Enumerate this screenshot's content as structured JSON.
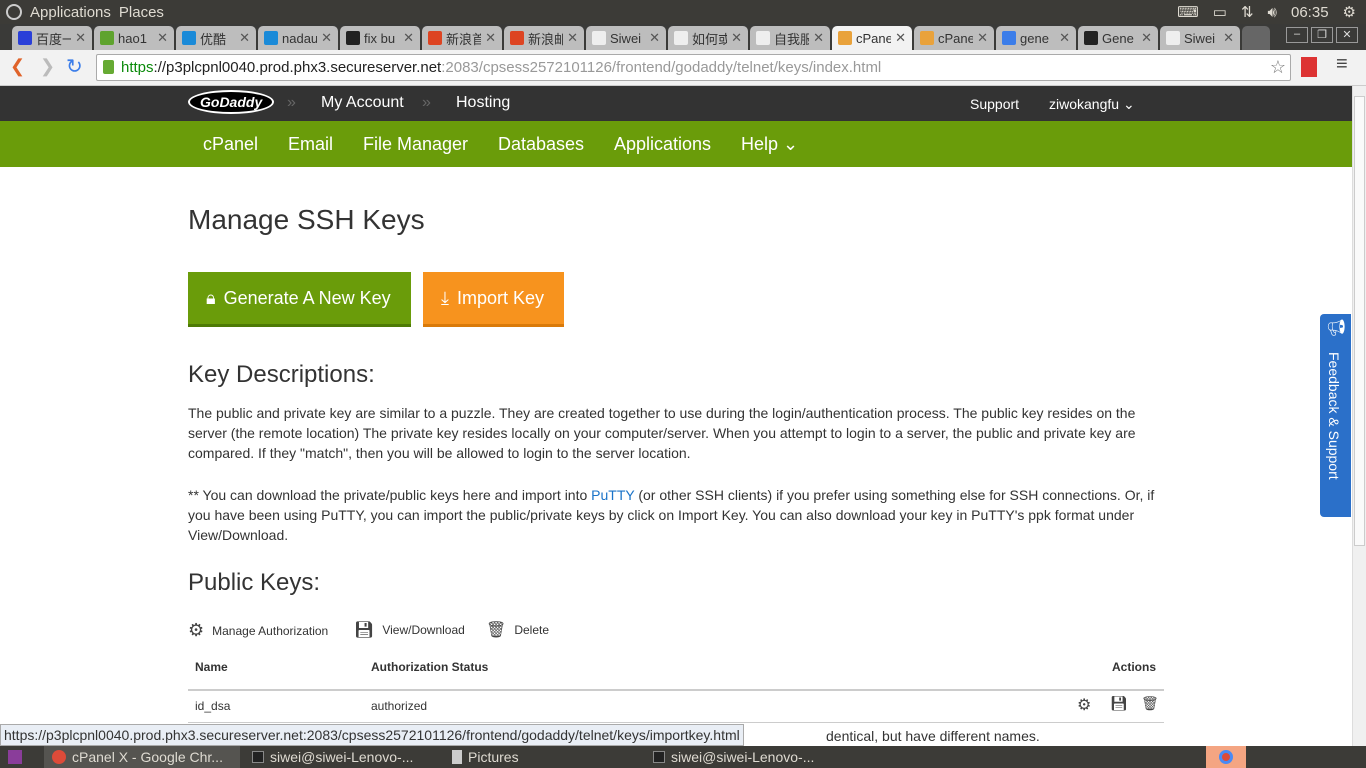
{
  "panel": {
    "applications": "Applications",
    "places": "Places",
    "time": "06:35"
  },
  "tabs": [
    {
      "label": "百度一",
      "color": "#2a3fd8"
    },
    {
      "label": "hao1",
      "color": "#5fa32e"
    },
    {
      "label": "优酷",
      "color": "#1a8ad8"
    },
    {
      "label": "nadau",
      "color": "#1a8ad8"
    },
    {
      "label": "fix bu",
      "color": "#222"
    },
    {
      "label": "新浪首",
      "color": "#d42"
    },
    {
      "label": "新浪邮",
      "color": "#d42"
    },
    {
      "label": "Siwei",
      "color": "#eee"
    },
    {
      "label": "如何或",
      "color": "#eee"
    },
    {
      "label": "自我服",
      "color": "#eee"
    },
    {
      "label": "cPane",
      "color": "#e9a23b",
      "active": true
    },
    {
      "label": "cPane",
      "color": "#e9a23b"
    },
    {
      "label": "gene",
      "color": "#3b7de9"
    },
    {
      "label": "Gene",
      "color": "#222"
    },
    {
      "label": "Siwei",
      "color": "#eee"
    }
  ],
  "url": {
    "scheme": "https",
    "host": "://p3plcpnl0040.prod.phx3.secureserver.net",
    "path": ":2083/cpsess2572101126/frontend/godaddy/telnet/keys/index.html"
  },
  "header": {
    "logo": "GoDaddy",
    "my_account": "My Account",
    "hosting": "Hosting",
    "support": "Support",
    "user": "ziwokangfu"
  },
  "nav": [
    "cPanel",
    "Email",
    "File Manager",
    "Databases",
    "Applications",
    "Help"
  ],
  "page": {
    "title": "Manage SSH Keys",
    "generate": "Generate A New Key",
    "import": "Import Key",
    "desc_title": "Key Descriptions:",
    "desc1": "The public and private key are similar to a puzzle. They are created together to use during the login/authentication process. The public key resides on the server (the remote location) The private key resides locally on your computer/server. When you attempt to login to a server, the public and private key are compared. If they \"match\", then you will be allowed to login to the server location.",
    "desc2_a": "** You can download the private/public keys here and import into ",
    "putty": "PuTTY",
    "desc2_b": " (or other SSH clients) if you prefer using something else for SSH connections. Or, if you have been using PuTTY, you can import the public/private keys by click on Import Key. You can also download your key in PuTTY's ppk format under View/Download.",
    "public_title": "Public Keys:",
    "actions": {
      "manage": "Manage Authorization",
      "view": "View/Download",
      "delete": "Delete"
    },
    "table": {
      "headers": [
        "Name",
        "Authorization Status",
        "Actions"
      ],
      "rows": [
        {
          "name": "id_dsa",
          "status": "authorized"
        }
      ]
    },
    "partial": "dentical, but have different names."
  },
  "colors": {
    "green": "#6a9c0a",
    "orange": "#f7931e",
    "feedback": "#2b70c9"
  },
  "feedback": "Feedback & Support",
  "status_url": "https://p3plcpnl0040.prod.phx3.secureserver.net:2083/cpsess2572101126/frontend/godaddy/telnet/keys/importkey.html",
  "taskbar": [
    "cPanel X - Google Chr...",
    "siwei@siwei-Lenovo-...",
    "Pictures",
    "siwei@siwei-Lenovo-..."
  ]
}
